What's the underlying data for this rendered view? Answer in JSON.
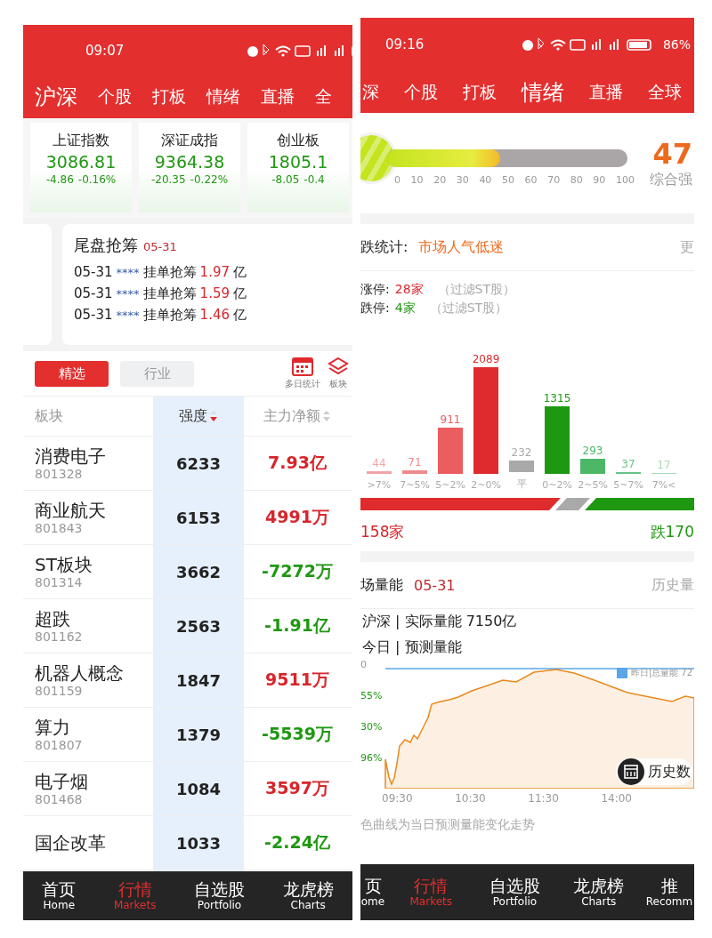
{
  "left": {
    "status_bar": {
      "time": "09:07"
    },
    "tabs": [
      {
        "label": "沪深",
        "selected": true
      },
      {
        "label": "个股",
        "selected": false
      },
      {
        "label": "打板",
        "selected": false
      },
      {
        "label": "情绪",
        "selected": false
      },
      {
        "label": "直播",
        "selected": false
      },
      {
        "label": "全",
        "selected": false
      }
    ],
    "indices": [
      {
        "name": "上证指数",
        "value": "3086.81",
        "change": "-4.86",
        "pct": "-0.16%",
        "rising": false
      },
      {
        "name": "深证成指",
        "value": "9364.38",
        "change": "-20.35",
        "pct": "-0.22%",
        "rising": false
      },
      {
        "name": "创业板",
        "value": "1805.1",
        "change": "-8.05",
        "pct": "-0.4",
        "rising": false
      }
    ],
    "notice": {
      "title": "尾盘抢筹",
      "date": "05-31",
      "items": [
        {
          "date": "05-31",
          "masked": "****",
          "text": "挂单抢筹",
          "amount": "1.97",
          "unit": "亿"
        },
        {
          "date": "05-31",
          "masked": "****",
          "text": "挂单抢筹",
          "amount": "1.59",
          "unit": "亿"
        },
        {
          "date": "05-31",
          "masked": "****",
          "text": "挂单抢筹",
          "amount": "1.46",
          "unit": "亿"
        }
      ]
    },
    "filters": [
      {
        "label": "精选",
        "selected": true
      },
      {
        "label": "行业",
        "selected": false
      }
    ],
    "tools": [
      {
        "label": "多日统计",
        "kind": "calendar"
      },
      {
        "label": "板块",
        "kind": "layers"
      }
    ],
    "table": {
      "columns": [
        "板块",
        "强度",
        "主力净额"
      ],
      "rows": [
        {
          "name": "消费电子",
          "code": "801328",
          "strength": "6233",
          "net": "7.93亿",
          "rising": true
        },
        {
          "name": "商业航天",
          "code": "801843",
          "strength": "6153",
          "net": "4991万",
          "rising": true
        },
        {
          "name": "ST板块",
          "code": "801314",
          "strength": "3662",
          "net": "-7272万",
          "rising": false
        },
        {
          "name": "超跌",
          "code": "801162",
          "strength": "2563",
          "net": "-1.91亿",
          "rising": false
        },
        {
          "name": "机器人概念",
          "code": "801159",
          "strength": "1847",
          "net": "9511万",
          "rising": true
        },
        {
          "name": "算力",
          "code": "801807",
          "strength": "1379",
          "net": "-5539万",
          "rising": false
        },
        {
          "name": "电子烟",
          "code": "801468",
          "strength": "1084",
          "net": "3597万",
          "rising": true
        },
        {
          "name": "国企改革",
          "strength": "1033",
          "net": "-2.24亿",
          "rising": false
        }
      ]
    },
    "nav": [
      {
        "label": "首页",
        "sub": "Home",
        "selected": false
      },
      {
        "label": "行情",
        "sub": "Markets",
        "selected": true
      },
      {
        "label": "自选股",
        "sub": "Portfolio",
        "selected": false
      },
      {
        "label": "龙虎榜",
        "sub": "Charts",
        "selected": false
      }
    ]
  },
  "right": {
    "status_bar": {
      "time": "09:16",
      "battery": "86%"
    },
    "tabs": [
      {
        "label": "深",
        "selected": false
      },
      {
        "label": "个股",
        "selected": false
      },
      {
        "label": "打板",
        "selected": false
      },
      {
        "label": "情绪",
        "selected": true
      },
      {
        "label": "直播",
        "selected": false
      },
      {
        "label": "全球",
        "selected": false
      }
    ],
    "gauge": {
      "level": 0.47,
      "ticks": [
        "0",
        "10",
        "20",
        "30",
        "40",
        "50",
        "60",
        "70",
        "80",
        "90",
        "100"
      ],
      "score": "47",
      "caption": "综合强"
    },
    "stats": {
      "label": "跌统计:",
      "mood": "市场人气低迷",
      "more": "更",
      "limit_up": {
        "label": "涨停:",
        "count": "28家",
        "note": "（过滤ST股）"
      },
      "limit_down": {
        "label": "跌停:",
        "count": "4家",
        "note": "（过滤ST股）"
      },
      "distribution": [
        {
          "range": ">7%",
          "count": "44",
          "color": "#f2a3a6"
        },
        {
          "range": "7~5%",
          "count": "71",
          "color": "#ee8a8d"
        },
        {
          "range": "5~2%",
          "count": "911",
          "color": "#ec5d60"
        },
        {
          "range": "2~0%",
          "count": "2089",
          "color": "#df2b2e"
        },
        {
          "range": "平",
          "count": "232",
          "color": "#a9a9a9"
        },
        {
          "range": "0~2%",
          "count": "1315",
          "color": "#1f9811"
        },
        {
          "range": "2~5%",
          "count": "293",
          "color": "#4cb867"
        },
        {
          "range": "5~7%",
          "count": "37",
          "color": "#66c487"
        },
        {
          "range": "7%<",
          "count": "17",
          "color": "#a7dcb7"
        }
      ],
      "up_total": "158家",
      "down_total": "跌170"
    },
    "volume": {
      "title": "场量能",
      "date": "05-31",
      "link": "历史量",
      "actual": "沪深 | 实际量能 7150亿",
      "forecast": "今日 | 预测量能",
      "legend": "昨日|总量能 72",
      "yticks": [
        "0",
        "55%",
        "30%",
        "96%"
      ],
      "xticks": [
        "09:30",
        "10:30",
        "11:30",
        "14:00"
      ],
      "history_button": "历史数",
      "caption": "色曲线为当日预测量能变化走势"
    },
    "nav": [
      {
        "label": "页",
        "sub": "ome",
        "selected": false
      },
      {
        "label": "行情",
        "sub": "Markets",
        "selected": true
      },
      {
        "label": "自选股",
        "sub": "Portfolio",
        "selected": false
      },
      {
        "label": "龙虎榜",
        "sub": "Charts",
        "selected": false
      },
      {
        "label": "推",
        "sub": "Recomm",
        "selected": false
      }
    ]
  }
}
